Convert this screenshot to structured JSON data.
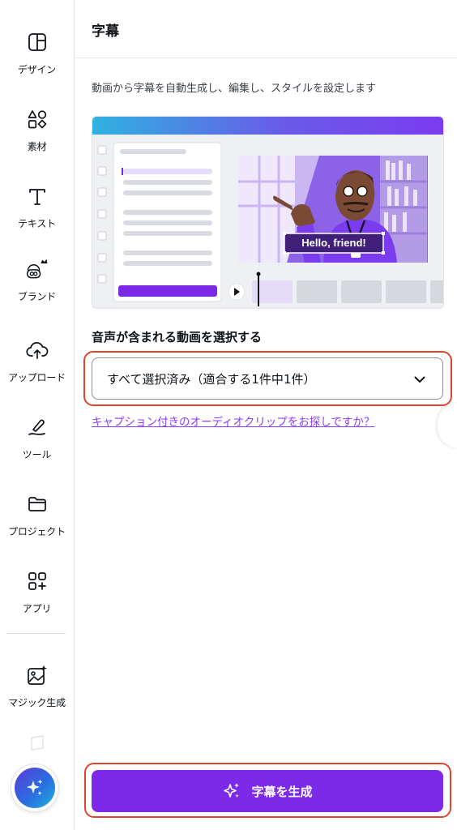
{
  "rail": {
    "items": [
      {
        "label": "デザイン",
        "icon": "design-layout-icon"
      },
      {
        "label": "素材",
        "icon": "elements-shapes-icon"
      },
      {
        "label": "テキスト",
        "icon": "text-T-icon"
      },
      {
        "label": "ブランド",
        "icon": "brand-icon"
      },
      {
        "label": "アップロード",
        "icon": "cloud-upload-icon"
      },
      {
        "label": "ツール",
        "icon": "draw-pen-icon"
      },
      {
        "label": "プロジェクト",
        "icon": "folder-icon"
      },
      {
        "label": "アプリ",
        "icon": "apps-grid-icon"
      },
      {
        "label": "マジック生成",
        "icon": "magic-media-icon"
      }
    ],
    "magic_button_icon": "sparkle-icon"
  },
  "panel": {
    "title": "字幕",
    "description": "動画から字幕を自動生成し、編集し、スタイルを設定します",
    "illustration": {
      "caption": "Hello, friend!"
    },
    "video_select": {
      "label": "音声が含まれる動画を選択する",
      "value": "すべて選択済み（適合する1件中1件）",
      "chevron_icon": "chevron-down-icon"
    },
    "audio_link": "キャプション付きのオーディオクリップをお探しですか？",
    "generate_button": {
      "label": "字幕を生成",
      "icon": "sparkles-icon"
    }
  },
  "colors": {
    "accent": "#7d2ae8",
    "link": "#8b3dff",
    "highlight": "#e0432e"
  }
}
